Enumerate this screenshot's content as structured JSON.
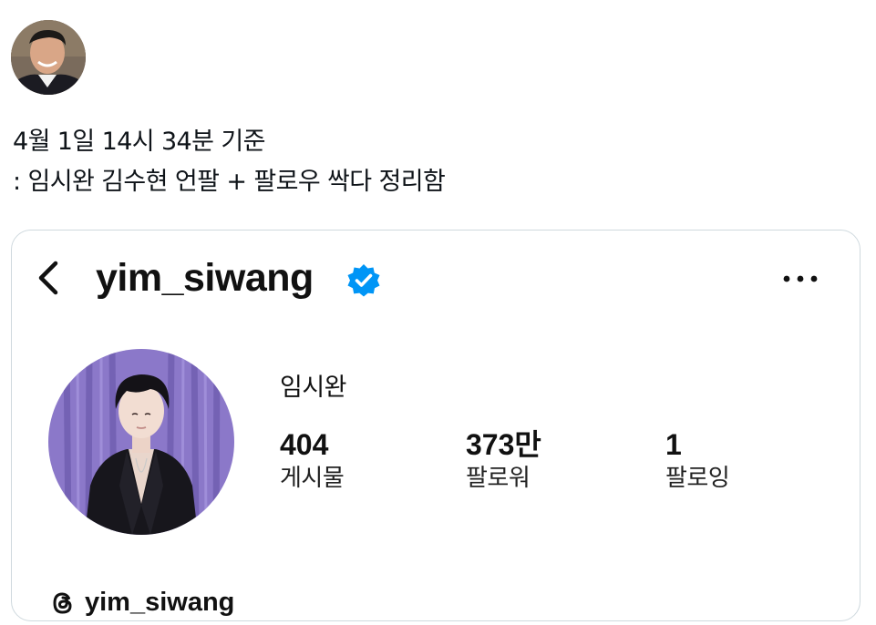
{
  "tweet": {
    "text_line1": "4월 1일 14시 34분 기준",
    "text_line2": ": 임시완 김수현 언팔 + 팔로우 싹다 정리함"
  },
  "instagram_card": {
    "username": "yim_siwang",
    "display_name": "임시완",
    "stats": [
      {
        "value": "404",
        "label": "게시물"
      },
      {
        "value": "373만",
        "label": "팔로워"
      },
      {
        "value": "1",
        "label": "팔로잉"
      }
    ],
    "threads_handle": "yim_siwang",
    "icons": {
      "back": "chevron-left-icon",
      "verified": "verified-badge-icon",
      "more": "more-horizontal-icon",
      "threads": "threads-logo-icon"
    },
    "colors": {
      "verified_blue": "#0095f6",
      "card_border": "#cfd9de"
    }
  }
}
